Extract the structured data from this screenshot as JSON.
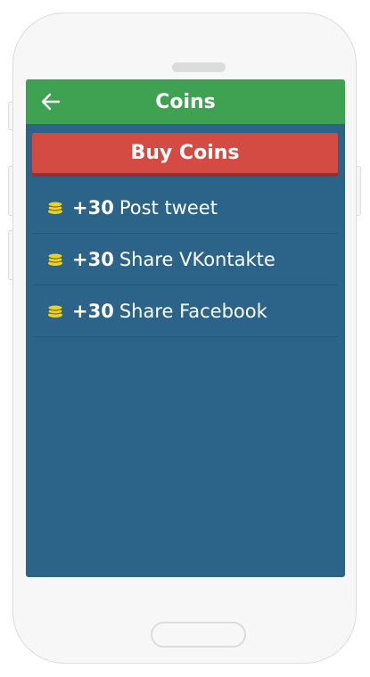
{
  "app_bar": {
    "title": "Coins",
    "back_icon": "arrow-left-icon"
  },
  "buy_button": {
    "label": "Buy Coins"
  },
  "actions": [
    {
      "amount": "+30",
      "label": "Post tweet",
      "icon": "coins-icon"
    },
    {
      "amount": "+30",
      "label": "Share VKontakte",
      "icon": "coins-icon"
    },
    {
      "amount": "+30",
      "label": "Share Facebook",
      "icon": "coins-icon"
    }
  ],
  "colors": {
    "app_bar": "#3ea252",
    "screen_bg": "#2c6489",
    "buy_button": "#d34b42",
    "coin": "#f2d118"
  }
}
